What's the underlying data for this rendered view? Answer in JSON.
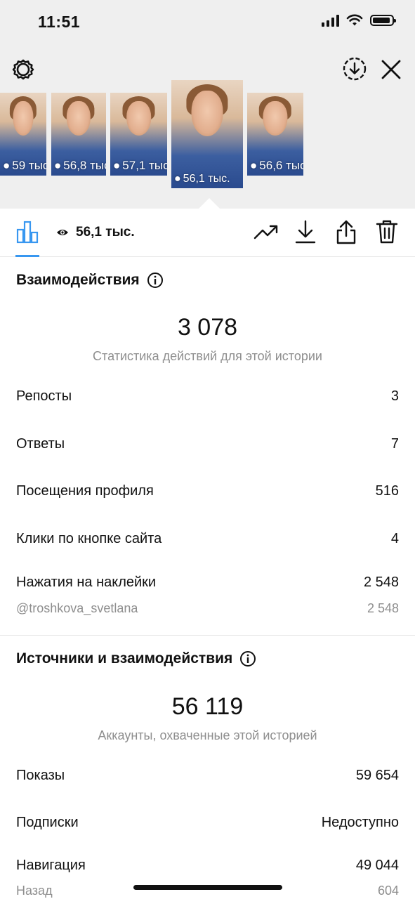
{
  "status_bar": {
    "time": "11:51"
  },
  "stories": [
    {
      "views": "59 тыс."
    },
    {
      "views": "56,8 тыс."
    },
    {
      "views": "57,1 тыс."
    },
    {
      "views": "56,1 тыс.",
      "active": true
    },
    {
      "views": "56,6 тыс."
    }
  ],
  "toolbar": {
    "views": "56,1 тыс."
  },
  "interactions": {
    "title": "Взаимодействия",
    "total": "3 078",
    "subtitle": "Статистика действий для этой истории",
    "rows": [
      {
        "label": "Репосты",
        "value": "3"
      },
      {
        "label": "Ответы",
        "value": "7"
      },
      {
        "label": "Посещения профиля",
        "value": "516"
      },
      {
        "label": "Клики по кнопке сайта",
        "value": "4"
      },
      {
        "label": "Нажатия на наклейки",
        "value": "2 548"
      }
    ],
    "sticker": {
      "label": "@troshkova_svetlana",
      "value": "2 548"
    }
  },
  "discovery": {
    "title": "Источники и взаимодействия",
    "total": "56 119",
    "subtitle": "Аккаунты, охваченные этой историей",
    "rows": [
      {
        "label": "Показы",
        "value": "59 654"
      },
      {
        "label": "Подписки",
        "value": "Недоступно"
      },
      {
        "label": "Навигация",
        "value": "49 044"
      }
    ],
    "back": {
      "label": "Назад",
      "value": "604"
    }
  },
  "colors": {
    "accent": "#3897f0",
    "muted": "#8e8e8e",
    "header_bg": "#efefef"
  }
}
